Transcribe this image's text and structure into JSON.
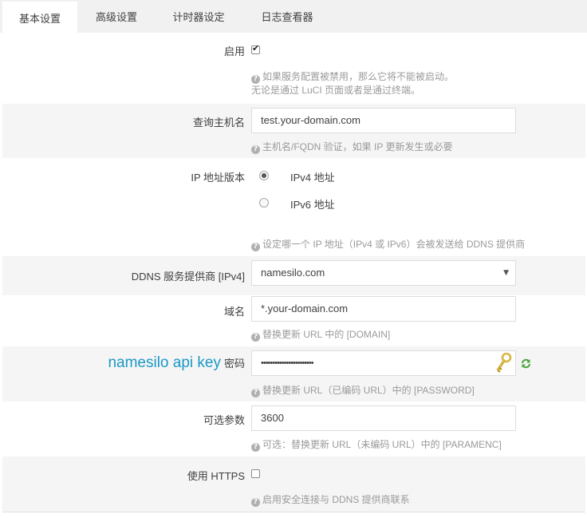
{
  "tabs": [
    {
      "label": "基本设置",
      "active": true
    },
    {
      "label": "高级设置",
      "active": false
    },
    {
      "label": "计时器设定",
      "active": false
    },
    {
      "label": "日志查看器",
      "active": false
    }
  ],
  "enable": {
    "label": "启用",
    "checked": true,
    "help_line1": "如果服务配置被禁用，那么它将不能被启动。",
    "help_line2": "无论是通过 LuCI 页面或者是通过终端。"
  },
  "lookup_host": {
    "label": "查询主机名",
    "value": "test.your-domain.com",
    "help": "主机名/FQDN 验证，如果 IP 更新发生或必要"
  },
  "ip_version": {
    "label": "IP 地址版本",
    "options": [
      {
        "label": "IPv4 地址",
        "selected": true
      },
      {
        "label": "IPv6 地址",
        "selected": false
      }
    ],
    "help": "设定哪一个 IP 地址（IPv4 或 IPv6）会被发送给 DDNS 提供商"
  },
  "provider": {
    "label": "DDNS 服务提供商 [IPv4]",
    "value": "namesilo.com"
  },
  "domain": {
    "label": "域名",
    "value": "*.your-domain.com",
    "help": "替换更新 URL 中的 [DOMAIN]"
  },
  "password": {
    "annotation": "namesilo api key",
    "annotation_color": "#1a98c6",
    "label": "密码",
    "value": "•••••••••••••••••••••••",
    "help": "替换更新 URL（已编码 URL）中的 [PASSWORD]"
  },
  "param_opt": {
    "label": "可选参数",
    "value": "3600",
    "help": "可选：替换更新 URL（未编码 URL）中的 [PARAMENC]"
  },
  "use_https": {
    "label": "使用 HTTPS",
    "checked": false,
    "help": "启用安全连接与 DDNS 提供商联系"
  },
  "icons": {
    "help": "question-circle-icon",
    "reveal": "key-icon",
    "reload": "refresh-icon"
  },
  "colors": {
    "annotation": "#1a98c6",
    "refresh": "#4aa33a",
    "key": "#d8b23a"
  }
}
